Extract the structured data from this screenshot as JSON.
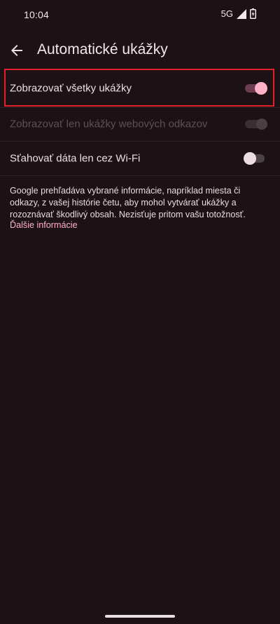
{
  "status_bar": {
    "time": "10:04",
    "network": "5G",
    "icons": [
      "signal-icon",
      "battery-icon"
    ]
  },
  "app_bar": {
    "back_icon": "arrow-left-icon",
    "title": "Automatické ukážky"
  },
  "settings": [
    {
      "label": "Zobrazovať všetky ukážky",
      "toggle": "on",
      "enabled": true
    },
    {
      "label": "Zobrazovať len ukážky webových odkazov",
      "toggle": "on",
      "enabled": false
    },
    {
      "label": "Sťahovať dáta len cez Wi-Fi",
      "toggle": "off",
      "enabled": true
    }
  ],
  "info": {
    "text": "Google prehľadáva vybrané informácie, napríklad miesta či odkazy, z vašej histórie četu, aby mohol vytvárať ukážky a rozoznávať škodlivý obsah. Nezisťuje pritom vašu totožnosť.",
    "link": "Ďalšie informácie"
  },
  "colors": {
    "background": "#1c1215",
    "accent": "#ffb1c8",
    "highlight": "#e0202a"
  }
}
